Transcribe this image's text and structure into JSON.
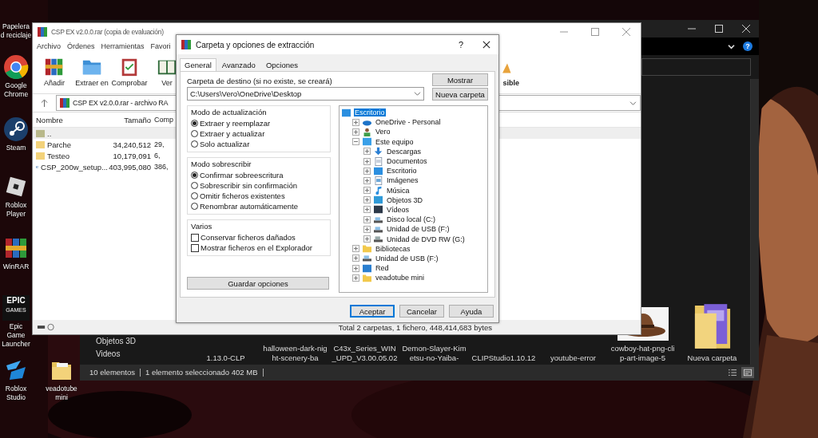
{
  "desktop": {
    "icons": [
      {
        "label": "Papelera d reciclaje",
        "kind": "recycle"
      },
      {
        "label": "Google Chrome",
        "kind": "chrome"
      },
      {
        "label": "Steam",
        "kind": "steam"
      },
      {
        "label": "Roblox Player",
        "kind": "roblox"
      },
      {
        "label": "WinRAR",
        "kind": "winrar"
      },
      {
        "label": "Epic Game Launcher",
        "kind": "epic",
        "logo": "EPIC",
        "logo_sub": "GAMES"
      },
      {
        "label": "Roblox Studio",
        "kind": "studio"
      },
      {
        "label": "veadotube mini",
        "kind": "folder"
      }
    ]
  },
  "explorer": {
    "help": "?",
    "nav_items": [
      "Objetos 3D",
      "Videos"
    ],
    "files": [
      {
        "name": "1.13.0-CLP"
      },
      {
        "name": "halloween-dark-night-scenery-ba"
      },
      {
        "name": "C43x_Series_WIN_UPD_V3.00.05.02"
      },
      {
        "name": "Demon-Slayer-Kimetsu-no-Yaiba-"
      },
      {
        "name": "CLIPStudio1.10.12"
      },
      {
        "name": "youtube-error"
      },
      {
        "name": "cowboy-hat-png-clip-art-image-5",
        "kind": "picture"
      },
      {
        "name": "Nueva carpeta",
        "kind": "folder"
      }
    ],
    "status_bar": {
      "count": "10 elementos",
      "selection": "1 elemento seleccionado  402 MB"
    },
    "views": [
      {
        "kind": "details",
        "selected": false
      },
      {
        "kind": "tiles",
        "selected": true
      }
    ]
  },
  "winrar": {
    "title": "CSP EX v2.0.0.rar (copia de evaluación)",
    "menu": [
      "Archivo",
      "Órdenes",
      "Herramientas",
      "Favori"
    ],
    "toolbar": [
      {
        "label": "Añadir",
        "kind": "books"
      },
      {
        "label": "Extraer en",
        "kind": "folder"
      },
      {
        "label": "Comprobar",
        "kind": "clipboard"
      },
      {
        "label": "Ver",
        "kind": "book"
      }
    ],
    "toolbar_partial": "sible",
    "path": "CSP EX v2.0.0.rar - archivo RA",
    "columns": [
      "Nombre",
      "Tamaño",
      "Comp"
    ],
    "rows": [
      {
        "name": "..",
        "kind": "up"
      },
      {
        "name": "Parche",
        "kind": "folder",
        "size": "34,240,512",
        "packed": "29,"
      },
      {
        "name": "Testeo",
        "kind": "folder",
        "size": "10,179,091",
        "packed": "6,"
      },
      {
        "name": "CSP_200w_setup...",
        "kind": "exe",
        "size": "403,995,080",
        "packed": "386,"
      }
    ],
    "status": "Total 2 carpetas, 1 fichero, 448,414,683 bytes"
  },
  "dialog": {
    "title": "Carpeta y opciones de extracción",
    "help": "?",
    "tabs": [
      {
        "label": "General",
        "selected": true
      },
      {
        "label": "Avanzado",
        "selected": false
      },
      {
        "label": "Opciones",
        "selected": false
      }
    ],
    "destination_label": "Carpeta de destino (si no existe, se creará)",
    "destination": "C:\\Users\\Vero\\OneDrive\\Desktop",
    "side_buttons": [
      "Mostrar",
      "Nueva carpeta"
    ],
    "groups": [
      {
        "title": "Modo de actualización",
        "kind": "radio",
        "options": [
          {
            "label": "Extraer y reemplazar",
            "selected": true
          },
          {
            "label": "Extraer y actualizar",
            "selected": false
          },
          {
            "label": "Solo actualizar",
            "selected": false
          }
        ]
      },
      {
        "title": "Modo sobrescribir",
        "kind": "radio",
        "options": [
          {
            "label": "Confirmar sobreescritura",
            "selected": true
          },
          {
            "label": "Sobrescribir sin confirmación",
            "selected": false
          },
          {
            "label": "Omitir ficheros existentes",
            "selected": false
          },
          {
            "label": "Renombrar automáticamente",
            "selected": false
          }
        ]
      },
      {
        "title": "Varios",
        "kind": "check",
        "options": [
          {
            "label": "Conservar ficheros dañados",
            "checked": false
          },
          {
            "label": "Mostrar ficheros en el Explorador",
            "checked": false
          }
        ]
      }
    ],
    "save_button": "Guardar opciones",
    "tree": [
      {
        "label": "Escritorio",
        "kind": "desktop",
        "selected": true,
        "children": [
          {
            "label": "OneDrive - Personal",
            "kind": "cloud",
            "selected": false,
            "expanded": false
          },
          {
            "label": "Vero",
            "kind": "user",
            "selected": false,
            "expanded": false
          },
          {
            "label": "Este equipo",
            "kind": "pc",
            "selected": false,
            "expanded": true,
            "children": [
              {
                "label": "Descargas",
                "kind": "download",
                "selected": false,
                "expanded": false
              },
              {
                "label": "Documentos",
                "kind": "docs",
                "selected": false,
                "expanded": false
              },
              {
                "label": "Escritorio",
                "kind": "desktop",
                "selected": false,
                "expanded": false
              },
              {
                "label": "Imágenes",
                "kind": "pictures",
                "selected": false,
                "expanded": false
              },
              {
                "label": "Música",
                "kind": "music",
                "selected": false,
                "expanded": false
              },
              {
                "label": "Objetos 3D",
                "kind": "cube",
                "selected": false,
                "expanded": false
              },
              {
                "label": "Vídeos",
                "kind": "video",
                "selected": false,
                "expanded": false
              },
              {
                "label": "Disco local (C:)",
                "kind": "disk",
                "selected": false,
                "expanded": false
              },
              {
                "label": "Unidad de USB (F:)",
                "kind": "disk",
                "selected": false,
                "expanded": false
              },
              {
                "label": "Unidad de DVD RW (G:)",
                "kind": "dvd",
                "selected": false,
                "expanded": false
              }
            ]
          },
          {
            "label": "Bibliotecas",
            "kind": "library",
            "selected": false,
            "expanded": false
          },
          {
            "label": "Unidad de USB (F:)",
            "kind": "disk",
            "selected": false,
            "expanded": false
          },
          {
            "label": "Red",
            "kind": "network",
            "selected": false,
            "expanded": false
          },
          {
            "label": "veadotube mini",
            "kind": "folder",
            "selected": false,
            "expanded": false
          }
        ]
      }
    ],
    "buttons": [
      {
        "label": "Aceptar",
        "kind": "default"
      },
      {
        "label": "Cancelar",
        "kind": "normal"
      },
      {
        "label": "Ayuda",
        "kind": "normal"
      }
    ]
  }
}
